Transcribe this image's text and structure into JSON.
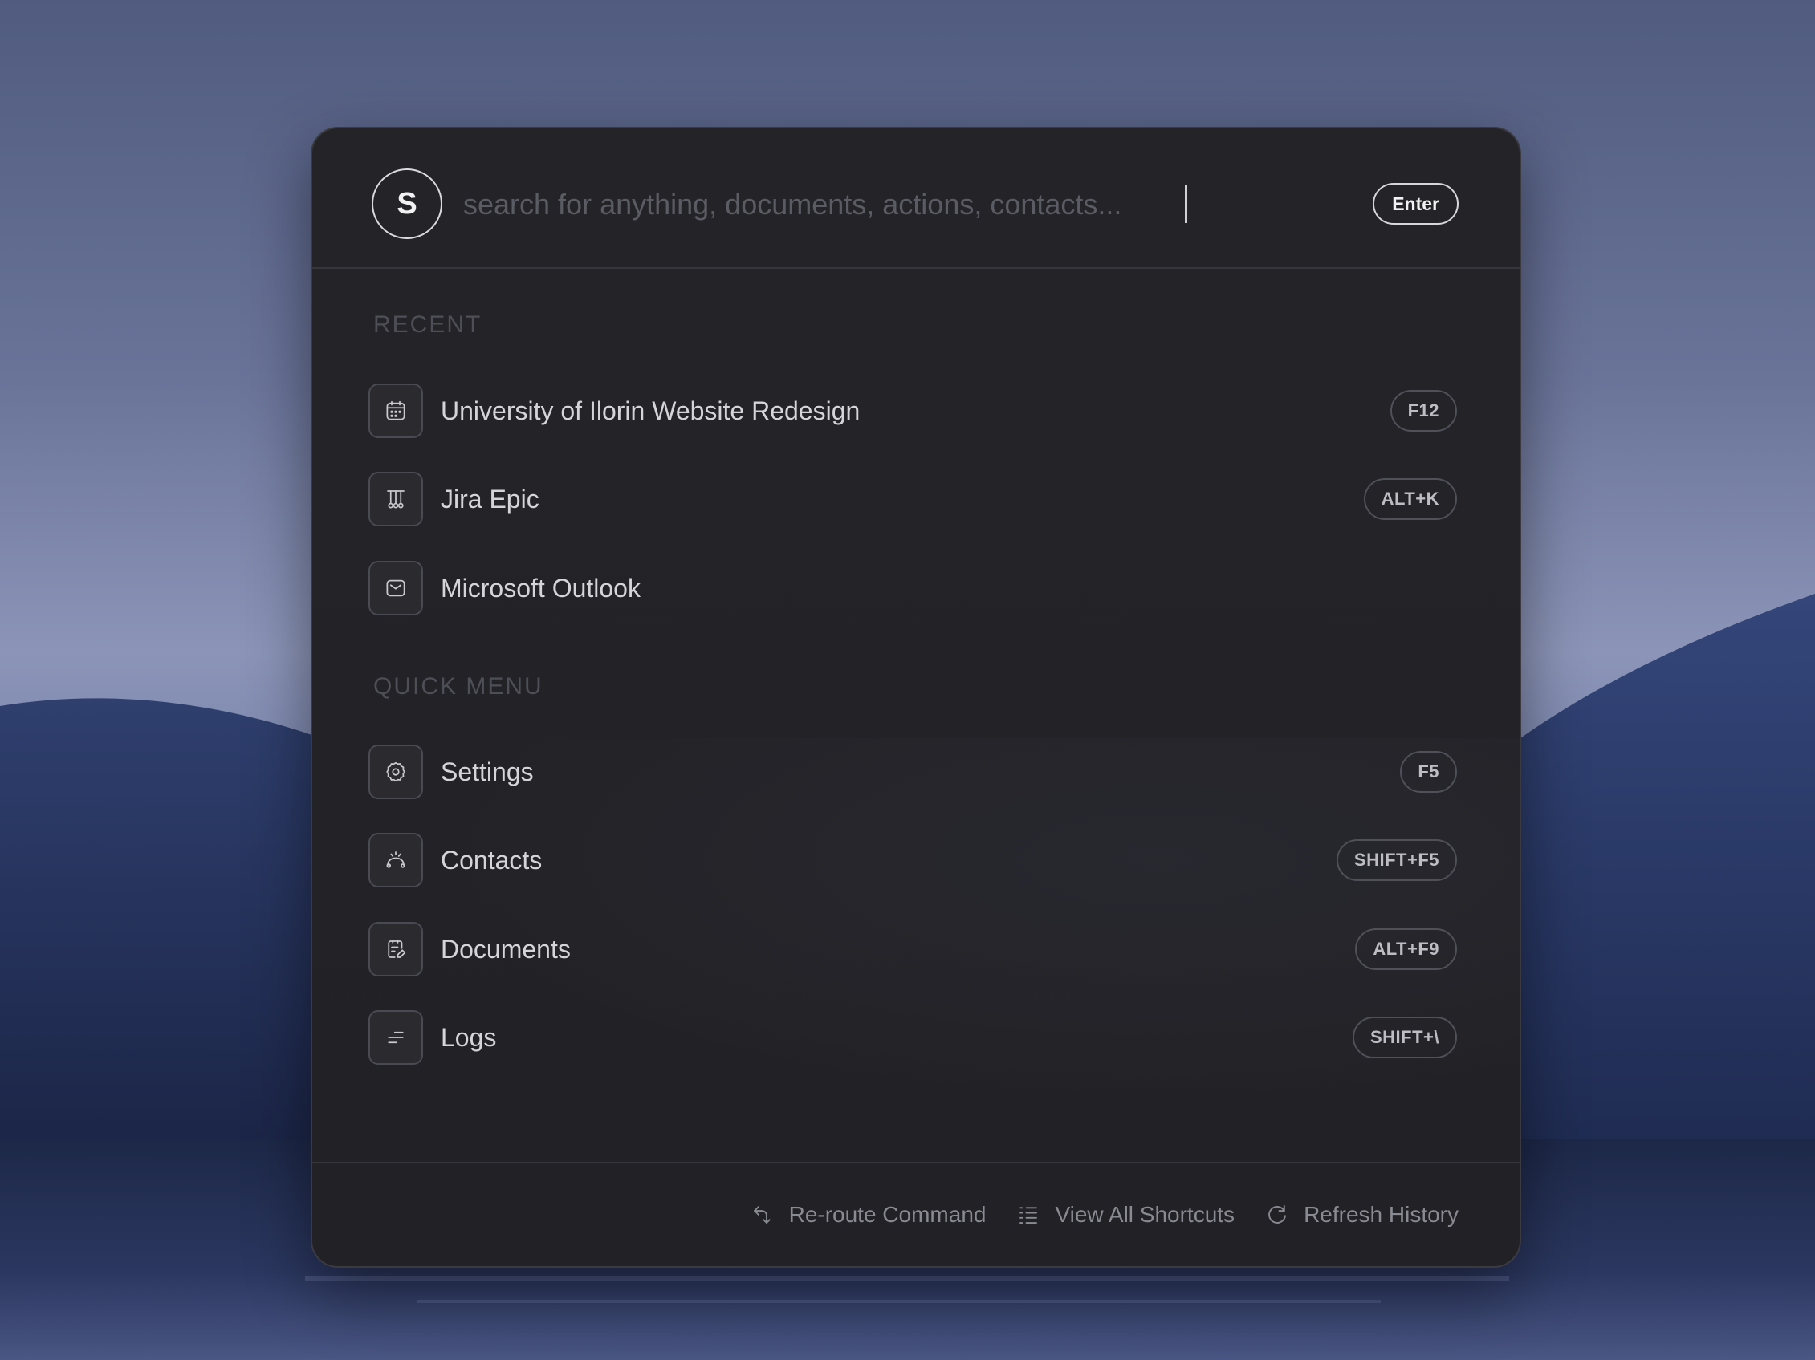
{
  "search": {
    "avatar_letter": "S",
    "placeholder": "search for anything, documents, actions, contacts...",
    "enter_label": "Enter"
  },
  "recent": {
    "title": "RECENT",
    "items": [
      {
        "label": "University of Ilorin Website Redesign",
        "shortcut": "F12",
        "icon": "calendar-icon"
      },
      {
        "label": "Jira Epic",
        "shortcut": "ALT+K",
        "icon": "jira-icon"
      },
      {
        "label": "Microsoft Outlook",
        "shortcut": "",
        "icon": "mail-icon"
      }
    ]
  },
  "quick_menu": {
    "title": "QUICK MENU",
    "items": [
      {
        "label": "Settings",
        "shortcut": "F5",
        "icon": "gear-icon"
      },
      {
        "label": "Contacts",
        "shortcut": "SHIFT+F5",
        "icon": "contacts-icon"
      },
      {
        "label": "Documents",
        "shortcut": "ALT+F9",
        "icon": "document-edit-icon"
      },
      {
        "label": "Logs",
        "shortcut": "SHIFT+\\",
        "icon": "logs-icon"
      }
    ]
  },
  "footer": {
    "reroute": "Re-route Command",
    "shortcuts": "View All Shortcuts",
    "refresh": "Refresh History"
  },
  "colors": {
    "panel_bg": "#232327",
    "text_primary": "#d4d4d9",
    "text_muted": "#8a8a92",
    "section_title": "#4e4e56"
  }
}
